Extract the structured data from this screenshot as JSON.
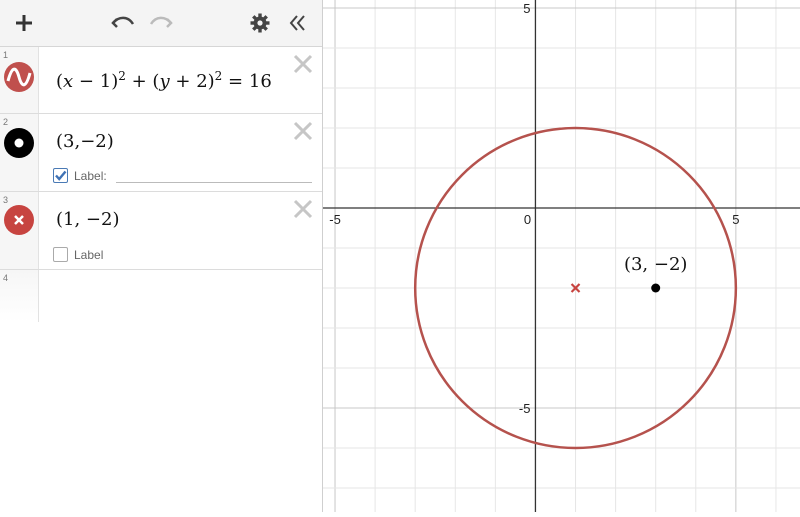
{
  "toolbar": {
    "add_icon": "plus-icon",
    "undo_icon": "undo-icon",
    "redo_icon": "redo-icon",
    "settings_icon": "gear-icon",
    "collapse_icon": "double-chevron-left-icon"
  },
  "expressions": [
    {
      "num": "1",
      "type": "curve",
      "color": "#c0504d",
      "icon": "wave-icon"
    },
    {
      "num": "2",
      "type": "point",
      "color": "#000000",
      "icon": "point-dot-icon",
      "label_text": "Label:",
      "label_checked": true
    },
    {
      "num": "3",
      "type": "point",
      "color": "#c74440",
      "icon": "x-mark-icon",
      "label_text": "Label",
      "label_checked": false
    },
    {
      "num": "4",
      "type": "empty"
    }
  ],
  "latex": {
    "e1": {
      "x": "x",
      "minus": "−",
      "one": "1",
      "sq": "2",
      "plus": "+",
      "y": "y",
      "two": "2",
      "eq": "=",
      "rhs": "16"
    },
    "e2": {
      "open": "(3,−2)"
    },
    "e3": {
      "open": "(1, −2)"
    }
  },
  "graph": {
    "x_range": [
      -5.3,
      6.6
    ],
    "y_range": [
      -7.6,
      5.2
    ],
    "x_ticks": [
      "-5",
      "0",
      "5"
    ],
    "y_ticks": [
      "5",
      "-5"
    ],
    "circle": {
      "cx": 1,
      "cy": -2,
      "r": 4,
      "color": "#b5524d"
    },
    "points": [
      {
        "x": 3,
        "y": -2,
        "label": "(3, −2)",
        "color": "#000000",
        "style": "dot"
      },
      {
        "x": 1,
        "y": -2,
        "color": "#c74440",
        "style": "cross"
      }
    ]
  }
}
